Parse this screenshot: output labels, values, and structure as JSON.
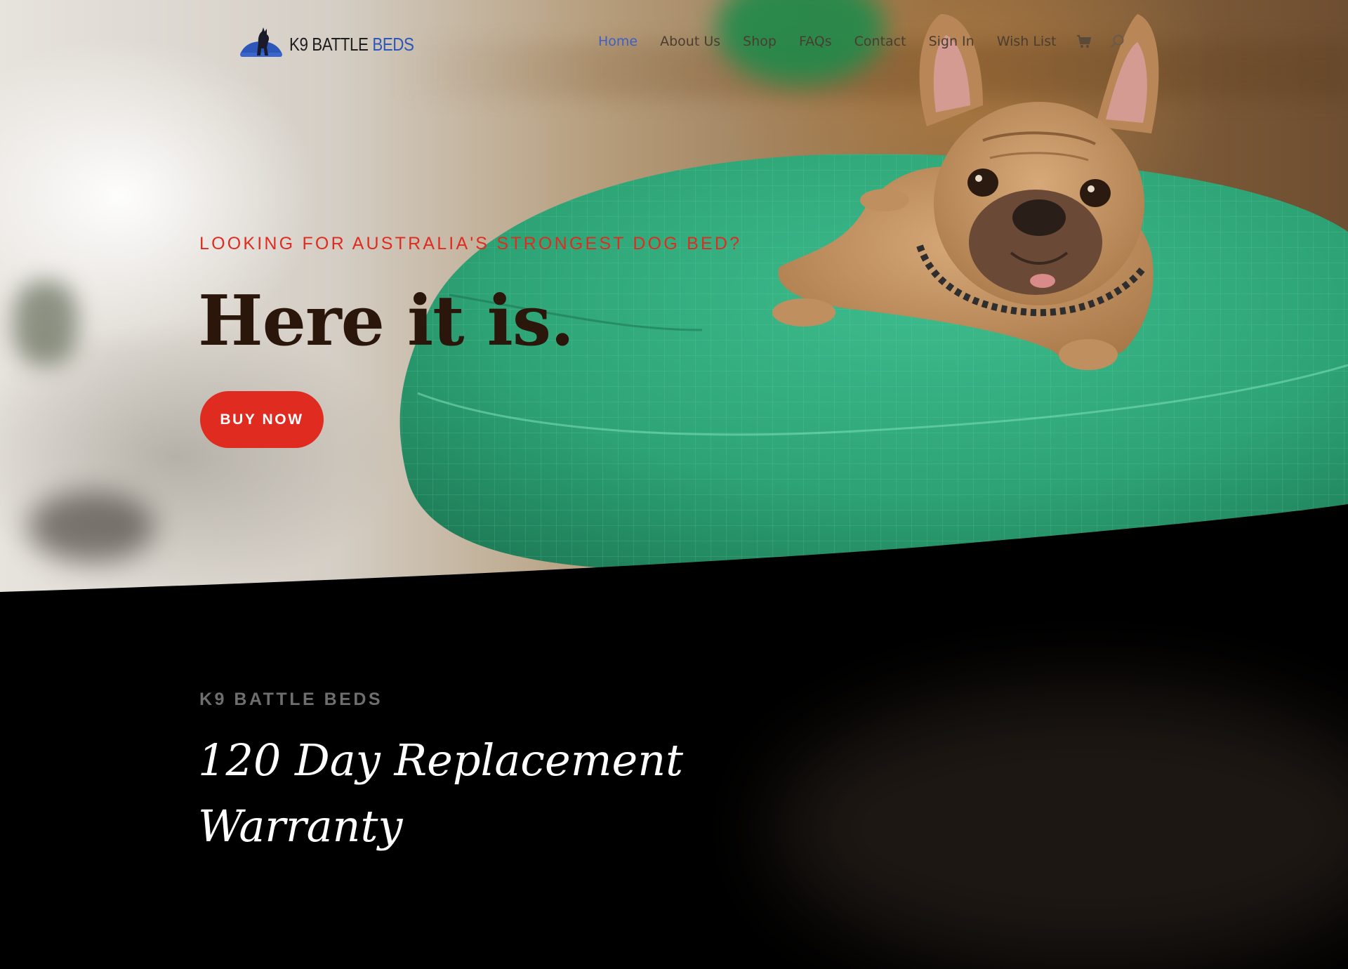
{
  "brand": {
    "name_main": "K9 BATTLE",
    "name_accent": "BEDS",
    "accent_color": "#2c56b8"
  },
  "nav": {
    "items": [
      {
        "label": "Home",
        "active": true
      },
      {
        "label": "About Us",
        "active": false
      },
      {
        "label": "Shop",
        "active": false
      },
      {
        "label": "FAQs",
        "active": false
      },
      {
        "label": "Contact",
        "active": false
      },
      {
        "label": "Sign In",
        "active": false
      },
      {
        "label": "Wish List",
        "active": false
      }
    ],
    "icons": [
      "cart-icon",
      "search-icon"
    ],
    "active_color": "#3d60c4"
  },
  "hero": {
    "tagline": "LOOKING FOR AUSTRALIA'S STRONGEST DOG BED?",
    "headline": "Here it is.",
    "cta_label": "BUY NOW",
    "accent_color": "#e02b20",
    "image": "french-bulldog-on-green-dog-bed"
  },
  "warranty": {
    "label": "K9 BATTLE BEDS",
    "title": "120 Day Replacement Warranty"
  }
}
